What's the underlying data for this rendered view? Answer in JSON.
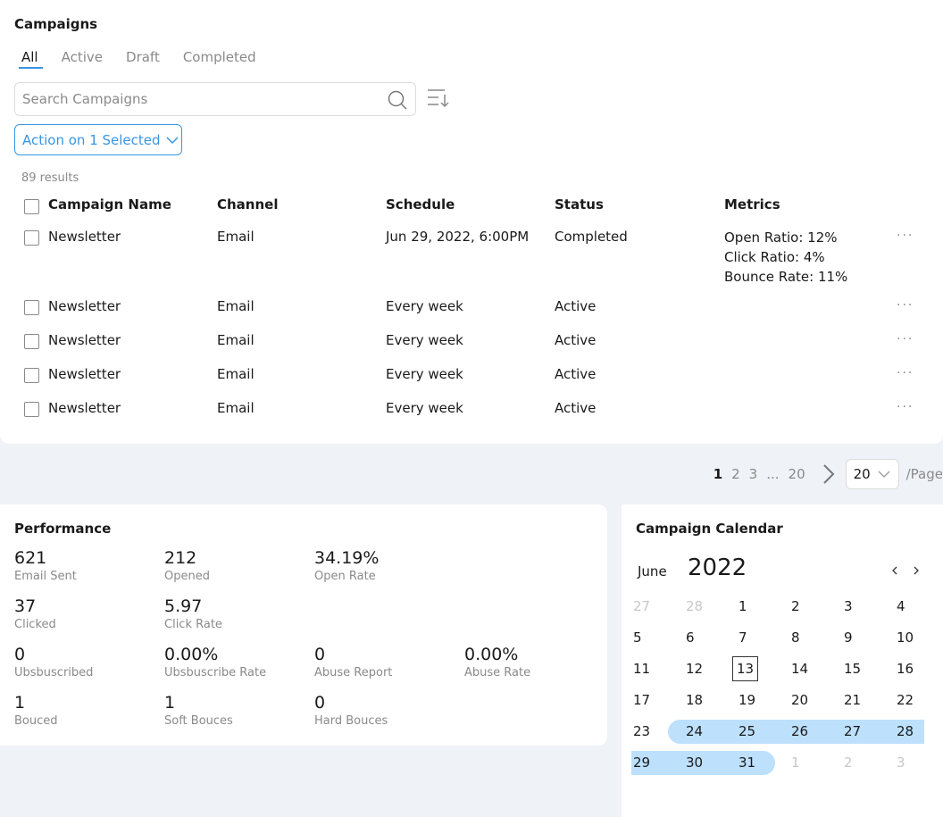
{
  "campaigns": {
    "title": "Campaigns",
    "tabs": [
      {
        "label": "All",
        "active": true
      },
      {
        "label": "Active",
        "active": false
      },
      {
        "label": "Draft",
        "active": false
      },
      {
        "label": "Completed",
        "active": false
      }
    ],
    "search": {
      "placeholder": "Search Campaigns",
      "value": ""
    },
    "action_button": "Action on 1 Selected",
    "results_count": "89 results",
    "columns": [
      "Campaign Name",
      "Channel",
      "Schedule",
      "Status",
      "Metrics"
    ],
    "rows": [
      {
        "name": "Newsletter",
        "channel": "Email",
        "schedule": "Jun 29, 2022, 6:00PM",
        "status": "Completed",
        "metrics": [
          "Open Ratio: 12%",
          "Click Ratio: 4%",
          "Bounce Rate: 11%"
        ],
        "more": "..."
      },
      {
        "name": "Newsletter",
        "channel": "Email",
        "schedule": "Every week",
        "status": "Active",
        "metrics": [],
        "more": "..."
      },
      {
        "name": "Newsletter",
        "channel": "Email",
        "schedule": "Every week",
        "status": "Active",
        "metrics": [],
        "more": "..."
      },
      {
        "name": "Newsletter",
        "channel": "Email",
        "schedule": "Every week",
        "status": "Active",
        "metrics": [],
        "more": "..."
      },
      {
        "name": "Newsletter",
        "channel": "Email",
        "schedule": "Every week",
        "status": "Active",
        "metrics": [],
        "more": "..."
      }
    ]
  },
  "pagination": {
    "pages": [
      "1",
      "2",
      "3",
      "...",
      "20"
    ],
    "current": "1",
    "page_size": "20",
    "unit": "/Page"
  },
  "performance": {
    "title": "Performance",
    "stats": [
      {
        "value": "621",
        "label": "Email Sent"
      },
      {
        "value": "212",
        "label": "Opened"
      },
      {
        "value": "34.19%",
        "label": "Open Rate"
      },
      {
        "value": "37",
        "label": "Clicked"
      },
      {
        "value": "5.97",
        "label": "Click Rate"
      },
      {
        "value": "0",
        "label": "Ubsbuscribed"
      },
      {
        "value": "0.00%",
        "label": "Ubsbuscribe Rate"
      },
      {
        "value": "0",
        "label": "Abuse Report"
      },
      {
        "value": "0.00%",
        "label": "Abuse Rate"
      },
      {
        "value": "1",
        "label": "Bouced"
      },
      {
        "value": "1",
        "label": "Soft Bouces"
      },
      {
        "value": "0",
        "label": "Hard Bouces"
      }
    ]
  },
  "calendar": {
    "title": "Campaign Calendar",
    "month": "June",
    "year": "2022",
    "today": "13",
    "weeks": [
      [
        "27",
        "28",
        "1",
        "2",
        "3",
        "4"
      ],
      [
        "5",
        "6",
        "7",
        "8",
        "9",
        "10"
      ],
      [
        "11",
        "12",
        "13",
        "14",
        "15",
        "16"
      ],
      [
        "17",
        "18",
        "19",
        "20",
        "21",
        "22"
      ],
      [
        "23",
        "24",
        "25",
        "26",
        "27",
        "28"
      ],
      [
        "29",
        "30",
        "31",
        "1",
        "2",
        "3"
      ]
    ],
    "muted": [
      [
        0,
        0
      ],
      [
        0,
        1
      ],
      [
        5,
        3
      ],
      [
        5,
        4
      ],
      [
        5,
        5
      ]
    ],
    "range": {
      "start": "24",
      "end": "31"
    },
    "colors": {
      "range": "#bde0fd",
      "accent": "#3a95e0"
    }
  }
}
